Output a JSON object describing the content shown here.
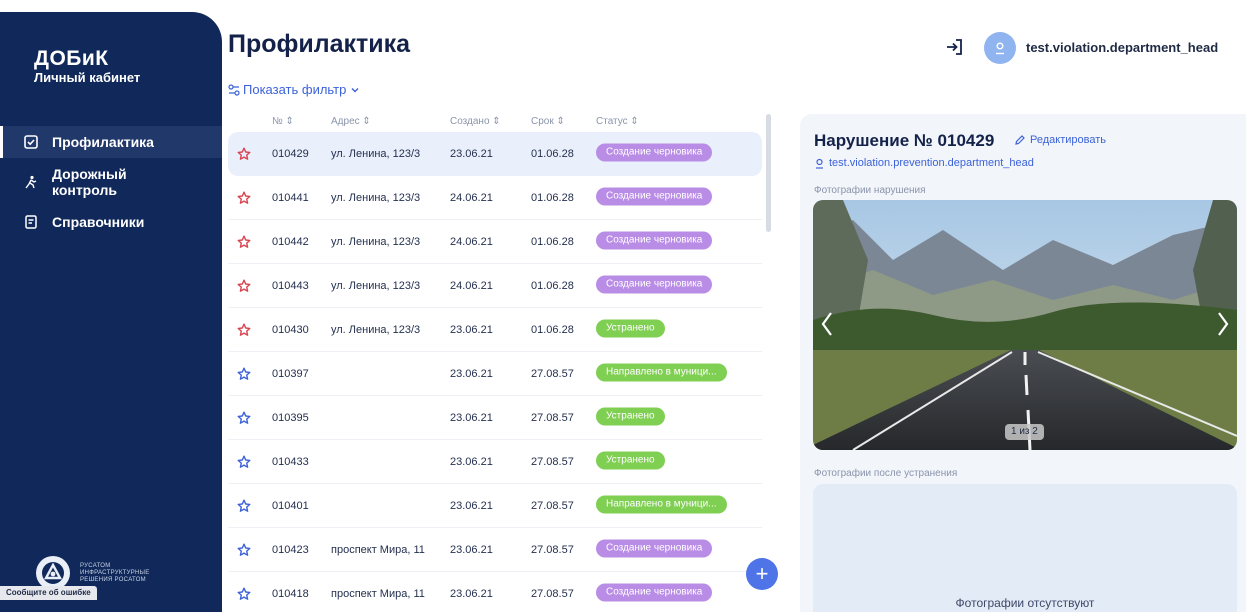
{
  "sidebar": {
    "brand_title": "ДОБиК",
    "brand_subtitle": "Личный кабинет",
    "items": [
      {
        "label": "Профилактика",
        "icon": "checkbox-icon"
      },
      {
        "label": "Дорожный контроль",
        "icon": "road-worker-icon"
      },
      {
        "label": "Справочники",
        "icon": "book-icon"
      }
    ],
    "logo_text": "РУСАТОМ ИНФРАСТРУКТУРНЫЕ РЕШЕНИЯ РОСАТОМ",
    "report_error": "Сообщите об ошибке"
  },
  "header": {
    "title": "Профилактика",
    "filter_toggle": "Показать фильтр",
    "username": "test.violation.department_head"
  },
  "table": {
    "columns": [
      "№",
      "Адрес",
      "Создано",
      "Срок",
      "Статус"
    ],
    "rows": [
      {
        "id": "010429",
        "address": "ул. Ленина, 123/3",
        "created": "23.06.21",
        "due": "01.06.28",
        "status": "Создание черновика",
        "status_type": "draft",
        "starred": true,
        "selected": true
      },
      {
        "id": "010441",
        "address": "ул. Ленина, 123/3",
        "created": "24.06.21",
        "due": "01.06.28",
        "status": "Создание черновика",
        "status_type": "draft",
        "starred": true
      },
      {
        "id": "010442",
        "address": "ул. Ленина, 123/3",
        "created": "24.06.21",
        "due": "01.06.28",
        "status": "Создание черновика",
        "status_type": "draft",
        "starred": true
      },
      {
        "id": "010443",
        "address": "ул. Ленина, 123/3",
        "created": "24.06.21",
        "due": "01.06.28",
        "status": "Создание черновика",
        "status_type": "draft",
        "starred": true
      },
      {
        "id": "010430",
        "address": "ул. Ленина, 123/3",
        "created": "23.06.21",
        "due": "01.06.28",
        "status": "Устранено",
        "status_type": "fixed",
        "starred": true
      },
      {
        "id": "010397",
        "address": "",
        "created": "23.06.21",
        "due": "27.08.57",
        "status": "Направлено в муници...",
        "status_type": "fixed",
        "starred": false
      },
      {
        "id": "010395",
        "address": "",
        "created": "23.06.21",
        "due": "27.08.57",
        "status": "Устранено",
        "status_type": "fixed",
        "starred": false
      },
      {
        "id": "010433",
        "address": "",
        "created": "23.06.21",
        "due": "27.08.57",
        "status": "Устранено",
        "status_type": "fixed",
        "starred": false
      },
      {
        "id": "010401",
        "address": "",
        "created": "23.06.21",
        "due": "27.08.57",
        "status": "Направлено в муници...",
        "status_type": "fixed",
        "starred": false
      },
      {
        "id": "010423",
        "address": "проспект Мира, 11",
        "created": "23.06.21",
        "due": "27.08.57",
        "status": "Создание черновика",
        "status_type": "draft",
        "starred": false
      },
      {
        "id": "010418",
        "address": "проспект Мира, 11",
        "created": "23.06.21",
        "due": "27.08.57",
        "status": "Создание черновика",
        "status_type": "draft",
        "starred": false
      }
    ]
  },
  "detail": {
    "title": "Нарушение № 010429",
    "edit_label": "Редактировать",
    "author": "test.violation.prevention.department_head",
    "photos_label": "Фотографии нарушения",
    "photo_counter": "1 из 2",
    "after_label": "Фотографии после устранения",
    "empty_text": "Фотографии отсутствуют"
  },
  "fab_label": "+",
  "colors": {
    "sidebar": "#10295a",
    "accent": "#3b62d8",
    "draft": "#b98de6",
    "fixed": "#7fcf52",
    "star_red": "#d9434f",
    "star_blue": "#3b62d8"
  }
}
